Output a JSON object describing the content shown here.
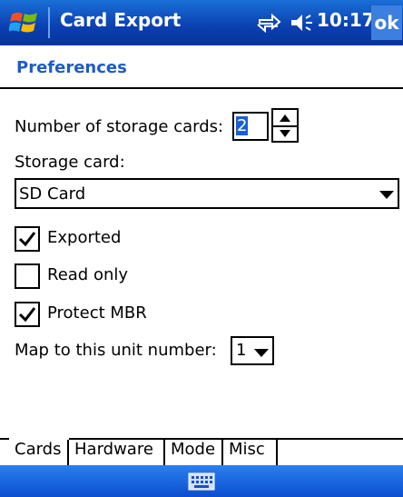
{
  "titlebar": {
    "app_title": "Card Export",
    "time": "10:17",
    "ok_label": "ok"
  },
  "page": {
    "header": "Preferences"
  },
  "fields": {
    "num_cards_label": "Number of storage cards:",
    "num_cards_value": "2",
    "storage_card_label": "Storage card:",
    "storage_card_value": "SD Card",
    "exported_label": "Exported",
    "exported_checked": true,
    "readonly_label": "Read only",
    "readonly_checked": false,
    "protect_label": "Protect MBR",
    "protect_checked": true,
    "unit_label": "Map to this unit number:",
    "unit_value": "1"
  },
  "tabs": [
    {
      "label": "Cards",
      "active": true
    },
    {
      "label": "Hardware",
      "active": false
    },
    {
      "label": "Mode",
      "active": false
    },
    {
      "label": "Misc",
      "active": false
    }
  ],
  "icons": {
    "start": "windows-flag-icon",
    "sync": "sync-arrows-icon",
    "volume": "speaker-icon",
    "keyboard": "keyboard-icon"
  },
  "colors": {
    "titlebar": "#0a3fb0",
    "header_text": "#1c5cc7",
    "selection": "#1a5fd6"
  }
}
